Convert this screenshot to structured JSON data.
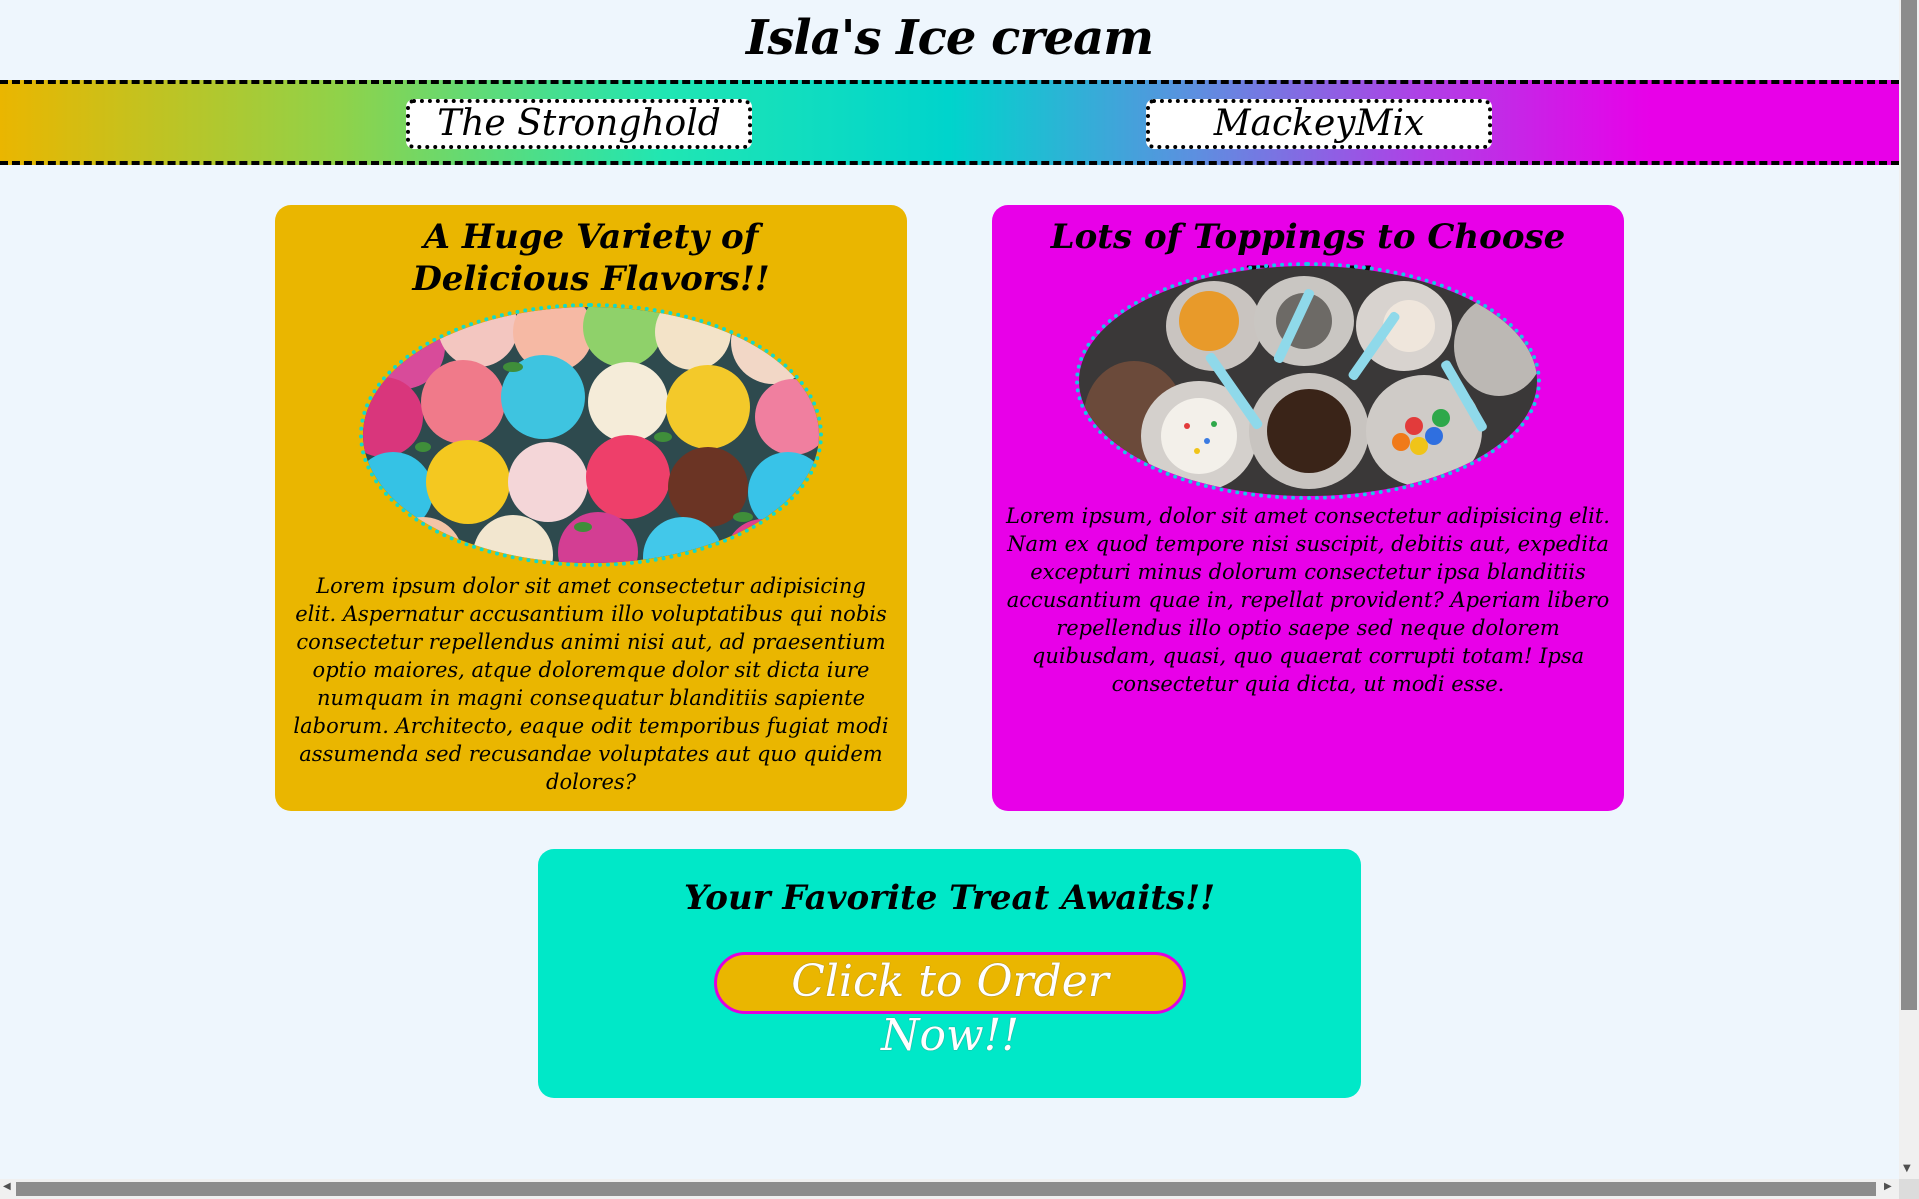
{
  "header": {
    "title": "Isla's Ice cream"
  },
  "nav": {
    "links": [
      {
        "label": "The Stronghold"
      },
      {
        "label": "MackeyMix"
      }
    ]
  },
  "cards": [
    {
      "heading": "A Huge Variety of Delicious Flavors!!",
      "text": "Lorem ipsum dolor sit amet consectetur adipisicing elit. Aspernatur accusantium illo voluptatibus qui nobis consectetur repellendus animi nisi aut, ad praesentium optio maiores, atque doloremque dolor sit dicta iure numquam in magni consequatur blanditiis sapiente laborum. Architecto, eaque odit temporibus fugiat modi assumenda sed recusandae voluptates aut quo quidem dolores?",
      "image": "ice-cream-scoops-photo"
    },
    {
      "heading": "Lots of Toppings to Choose From!!",
      "text": "Lorem ipsum, dolor sit amet consectetur adipisicing elit. Nam ex quod tempore nisi suscipit, debitis aut, expedita excepturi minus dolorum consectetur ipsa blanditiis accusantium quae in, repellat provident? Aperiam libero repellendus illo optio saepe sed neque dolorem quibusdam, quasi, quo quaerat corrupti totam! Ipsa consectetur quia dicta, ut modi esse.",
      "image": "toppings-jars-photo"
    }
  ],
  "cta": {
    "heading": "Your Favorite Treat Awaits!!",
    "button_label": "Click to Order Now!!"
  },
  "colors": {
    "background": "#eef6fd",
    "gold": "#eab600",
    "magenta": "#e800e8",
    "teal": "#00e8c8"
  }
}
